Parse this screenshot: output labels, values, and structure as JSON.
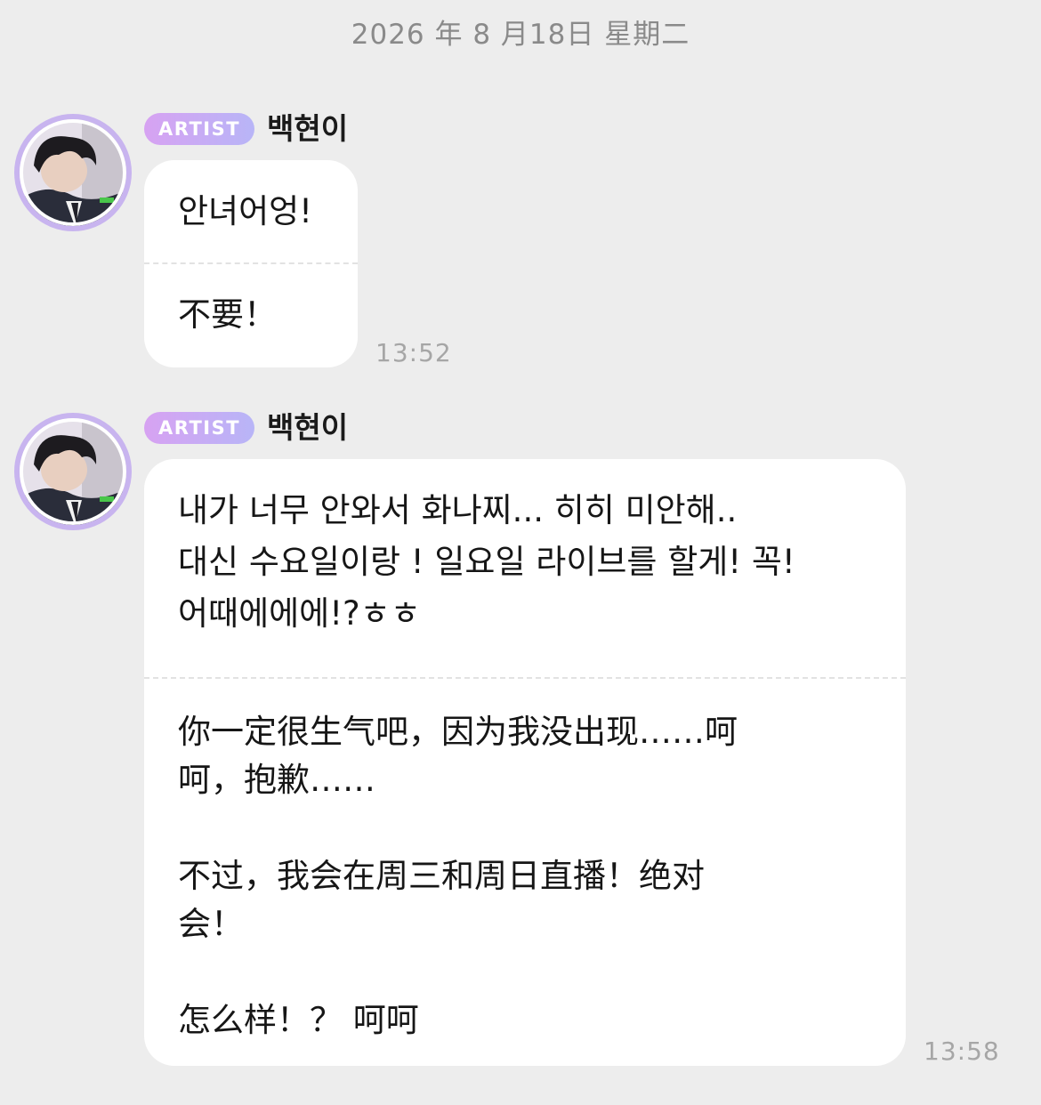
{
  "date_header": "2026 年 8 月18日  星期二",
  "messages": [
    {
      "badge": "ARTIST",
      "sender": "백현이",
      "original": "안녀어엉!",
      "translation": "不要！",
      "time": "13:52"
    },
    {
      "badge": "ARTIST",
      "sender": "백현이",
      "original": "내가 너무 안와서 화나찌... 히히 미안해..\n대신 수요일이랑 ! 일요일 라이브를 할게! 꼭!\n어때에에에!?ㅎㅎ",
      "translation": "你一定很生气吧，因为我没出现……呵\n呵，抱歉……\n\n不过，我会在周三和周日直播！绝对\n会！\n\n怎么样！？ 呵呵",
      "time": "13:58"
    }
  ],
  "colors": {
    "background": "#ededed",
    "bubble": "#ffffff",
    "badge_start": "#d7a2f2",
    "badge_end": "#b8b5f7",
    "avatar_ring": "#c8b4ef"
  },
  "icons": {
    "avatar": "user-photo-avatar"
  }
}
